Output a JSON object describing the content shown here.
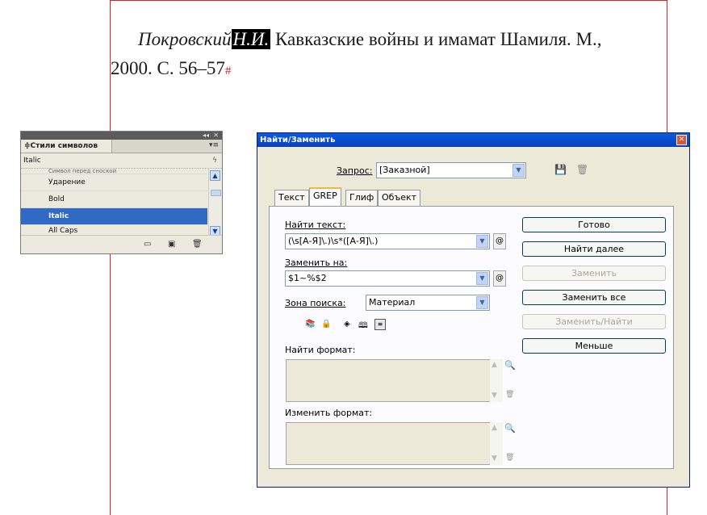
{
  "document": {
    "line1": {
      "author_italic": "Покровский",
      "selected_initials": "Н.И.",
      "rest": " Кавказские войны и имамат Шамиля. М.,"
    },
    "line2": {
      "text": "2000. С. 56–57",
      "end_marker": "#"
    }
  },
  "char_styles_panel": {
    "collapse_label": "◂◂",
    "close_label": "✕",
    "tab_label": "≑Стили символов",
    "menu_label": "▾≡",
    "current_style": "Italic",
    "bolt_icon": "ϟ",
    "items": [
      {
        "label": "Символ перед сноской",
        "selected": false
      },
      {
        "label": "Ударение",
        "selected": false
      },
      {
        "label": "Bold",
        "selected": false
      },
      {
        "label": "Italic",
        "selected": true
      },
      {
        "label": "All Caps",
        "selected": false
      }
    ]
  },
  "find_change": {
    "title": "Найти/Заменить",
    "query_label": "Запрос:",
    "query_value": "[Заказной]",
    "tabs": [
      "Текст",
      "GREP",
      "Глиф",
      "Объект"
    ],
    "active_tab": "GREP",
    "find_label": "Найти текст:",
    "find_value": "(\\s[А-Я]\\.)\\s*([А-Я]\\.)",
    "change_label": "Заменить на:",
    "change_value": "$1~%$2",
    "search_label": "Зона поиска:",
    "search_value": "Материал",
    "find_format_label": "Найти формат:",
    "change_format_label": "Изменить формат:",
    "buttons": {
      "done": "Готово",
      "find_next": "Найти далее",
      "change": "Заменить",
      "change_all": "Заменить все",
      "change_find": "Заменить/Найти",
      "fewer": "Меньше"
    }
  }
}
